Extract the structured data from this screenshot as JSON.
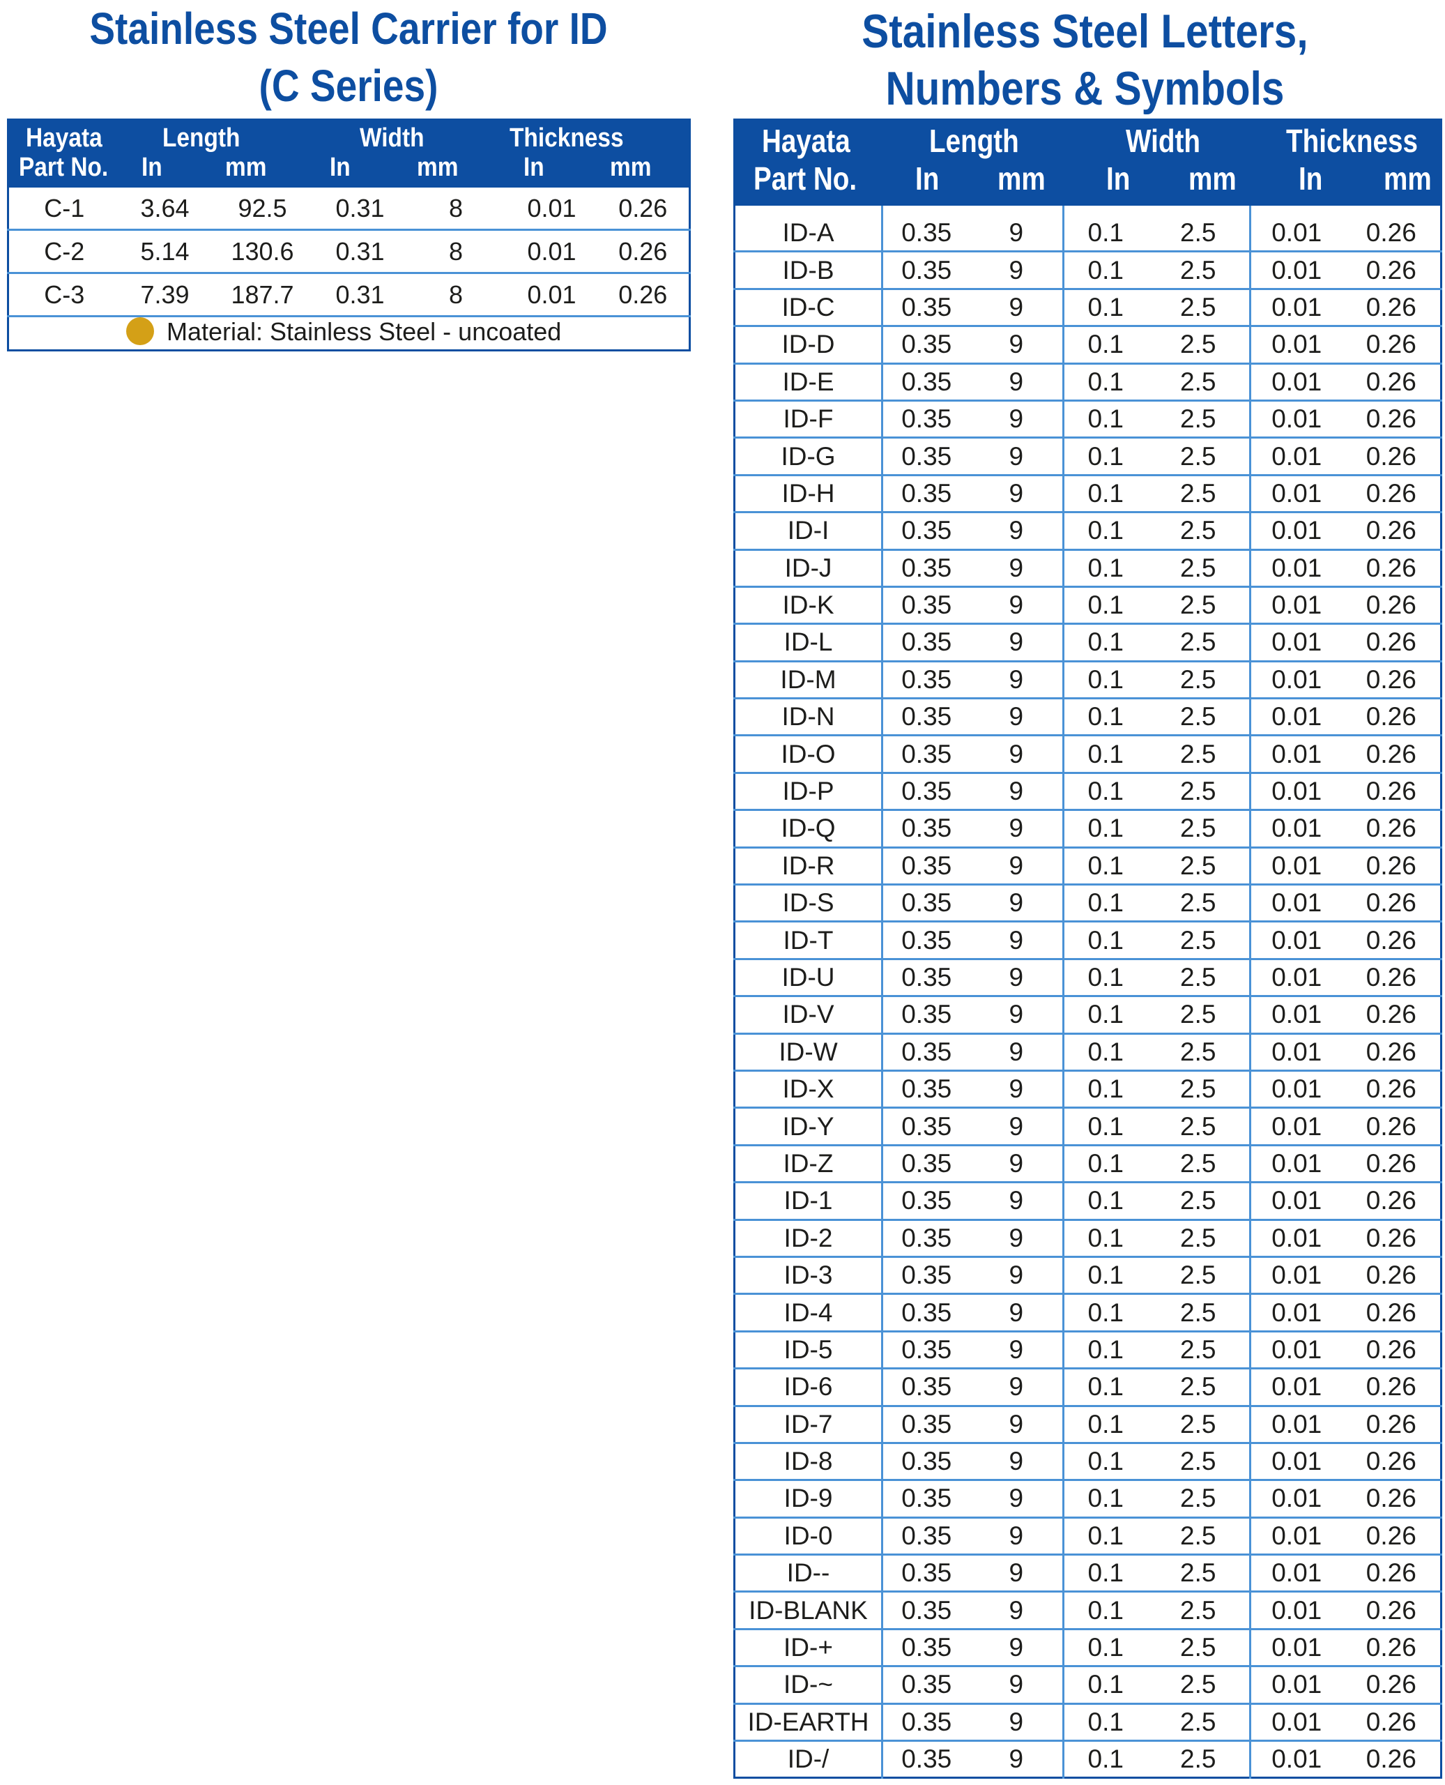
{
  "left": {
    "title_line1": "Stainless Steel Carrier for ID",
    "title_line2": "(C Series)",
    "headers": {
      "part_line1": "Hayata",
      "part_line2": "Part No.",
      "length": "Length",
      "width": "Width",
      "thickness": "Thickness",
      "in": "In",
      "mm": "mm"
    },
    "rows": [
      [
        "C-1",
        "3.64",
        "92.5",
        "0.31",
        "8",
        "0.01",
        "0.26"
      ],
      [
        "C-2",
        "5.14",
        "130.6",
        "0.31",
        "8",
        "0.01",
        "0.26"
      ],
      [
        "C-3",
        "7.39",
        "187.7",
        "0.31",
        "8",
        "0.01",
        "0.26"
      ]
    ],
    "note": "Material: Stainless Steel - uncoated",
    "note_dot_color": "#d4a017"
  },
  "right": {
    "title_line1": "Stainless Steel Letters,",
    "title_line2": "Numbers & Symbols",
    "headers": {
      "part_line1": "Hayata",
      "part_line2": "Part No.",
      "length": "Length",
      "width": "Width",
      "thickness": "Thickness",
      "in": "In",
      "mm": "mm"
    },
    "rows": [
      [
        "ID-A",
        "0.35",
        "9",
        "0.1",
        "2.5",
        "0.01",
        "0.26"
      ],
      [
        "ID-B",
        "0.35",
        "9",
        "0.1",
        "2.5",
        "0.01",
        "0.26"
      ],
      [
        "ID-C",
        "0.35",
        "9",
        "0.1",
        "2.5",
        "0.01",
        "0.26"
      ],
      [
        "ID-D",
        "0.35",
        "9",
        "0.1",
        "2.5",
        "0.01",
        "0.26"
      ],
      [
        "ID-E",
        "0.35",
        "9",
        "0.1",
        "2.5",
        "0.01",
        "0.26"
      ],
      [
        "ID-F",
        "0.35",
        "9",
        "0.1",
        "2.5",
        "0.01",
        "0.26"
      ],
      [
        "ID-G",
        "0.35",
        "9",
        "0.1",
        "2.5",
        "0.01",
        "0.26"
      ],
      [
        "ID-H",
        "0.35",
        "9",
        "0.1",
        "2.5",
        "0.01",
        "0.26"
      ],
      [
        "ID-I",
        "0.35",
        "9",
        "0.1",
        "2.5",
        "0.01",
        "0.26"
      ],
      [
        "ID-J",
        "0.35",
        "9",
        "0.1",
        "2.5",
        "0.01",
        "0.26"
      ],
      [
        "ID-K",
        "0.35",
        "9",
        "0.1",
        "2.5",
        "0.01",
        "0.26"
      ],
      [
        "ID-L",
        "0.35",
        "9",
        "0.1",
        "2.5",
        "0.01",
        "0.26"
      ],
      [
        "ID-M",
        "0.35",
        "9",
        "0.1",
        "2.5",
        "0.01",
        "0.26"
      ],
      [
        "ID-N",
        "0.35",
        "9",
        "0.1",
        "2.5",
        "0.01",
        "0.26"
      ],
      [
        "ID-O",
        "0.35",
        "9",
        "0.1",
        "2.5",
        "0.01",
        "0.26"
      ],
      [
        "ID-P",
        "0.35",
        "9",
        "0.1",
        "2.5",
        "0.01",
        "0.26"
      ],
      [
        "ID-Q",
        "0.35",
        "9",
        "0.1",
        "2.5",
        "0.01",
        "0.26"
      ],
      [
        "ID-R",
        "0.35",
        "9",
        "0.1",
        "2.5",
        "0.01",
        "0.26"
      ],
      [
        "ID-S",
        "0.35",
        "9",
        "0.1",
        "2.5",
        "0.01",
        "0.26"
      ],
      [
        "ID-T",
        "0.35",
        "9",
        "0.1",
        "2.5",
        "0.01",
        "0.26"
      ],
      [
        "ID-U",
        "0.35",
        "9",
        "0.1",
        "2.5",
        "0.01",
        "0.26"
      ],
      [
        "ID-V",
        "0.35",
        "9",
        "0.1",
        "2.5",
        "0.01",
        "0.26"
      ],
      [
        "ID-W",
        "0.35",
        "9",
        "0.1",
        "2.5",
        "0.01",
        "0.26"
      ],
      [
        "ID-X",
        "0.35",
        "9",
        "0.1",
        "2.5",
        "0.01",
        "0.26"
      ],
      [
        "ID-Y",
        "0.35",
        "9",
        "0.1",
        "2.5",
        "0.01",
        "0.26"
      ],
      [
        "ID-Z",
        "0.35",
        "9",
        "0.1",
        "2.5",
        "0.01",
        "0.26"
      ],
      [
        "ID-1",
        "0.35",
        "9",
        "0.1",
        "2.5",
        "0.01",
        "0.26"
      ],
      [
        "ID-2",
        "0.35",
        "9",
        "0.1",
        "2.5",
        "0.01",
        "0.26"
      ],
      [
        "ID-3",
        "0.35",
        "9",
        "0.1",
        "2.5",
        "0.01",
        "0.26"
      ],
      [
        "ID-4",
        "0.35",
        "9",
        "0.1",
        "2.5",
        "0.01",
        "0.26"
      ],
      [
        "ID-5",
        "0.35",
        "9",
        "0.1",
        "2.5",
        "0.01",
        "0.26"
      ],
      [
        "ID-6",
        "0.35",
        "9",
        "0.1",
        "2.5",
        "0.01",
        "0.26"
      ],
      [
        "ID-7",
        "0.35",
        "9",
        "0.1",
        "2.5",
        "0.01",
        "0.26"
      ],
      [
        "ID-8",
        "0.35",
        "9",
        "0.1",
        "2.5",
        "0.01",
        "0.26"
      ],
      [
        "ID-9",
        "0.35",
        "9",
        "0.1",
        "2.5",
        "0.01",
        "0.26"
      ],
      [
        "ID-0",
        "0.35",
        "9",
        "0.1",
        "2.5",
        "0.01",
        "0.26"
      ],
      [
        "ID--",
        "0.35",
        "9",
        "0.1",
        "2.5",
        "0.01",
        "0.26"
      ],
      [
        "ID-BLANK",
        "0.35",
        "9",
        "0.1",
        "2.5",
        "0.01",
        "0.26"
      ],
      [
        "ID-+",
        "0.35",
        "9",
        "0.1",
        "2.5",
        "0.01",
        "0.26"
      ],
      [
        "ID-~",
        "0.35",
        "9",
        "0.1",
        "2.5",
        "0.01",
        "0.26"
      ],
      [
        "ID-EARTH",
        "0.35",
        "9",
        "0.1",
        "2.5",
        "0.01",
        "0.26"
      ],
      [
        "ID-/",
        "0.35",
        "9",
        "0.1",
        "2.5",
        "0.01",
        "0.26"
      ]
    ]
  },
  "colors": {
    "title": "#0d4ea1",
    "header_bg": "#0d4ea1",
    "rule": "#4a92d6",
    "dot": "#d4a017"
  }
}
